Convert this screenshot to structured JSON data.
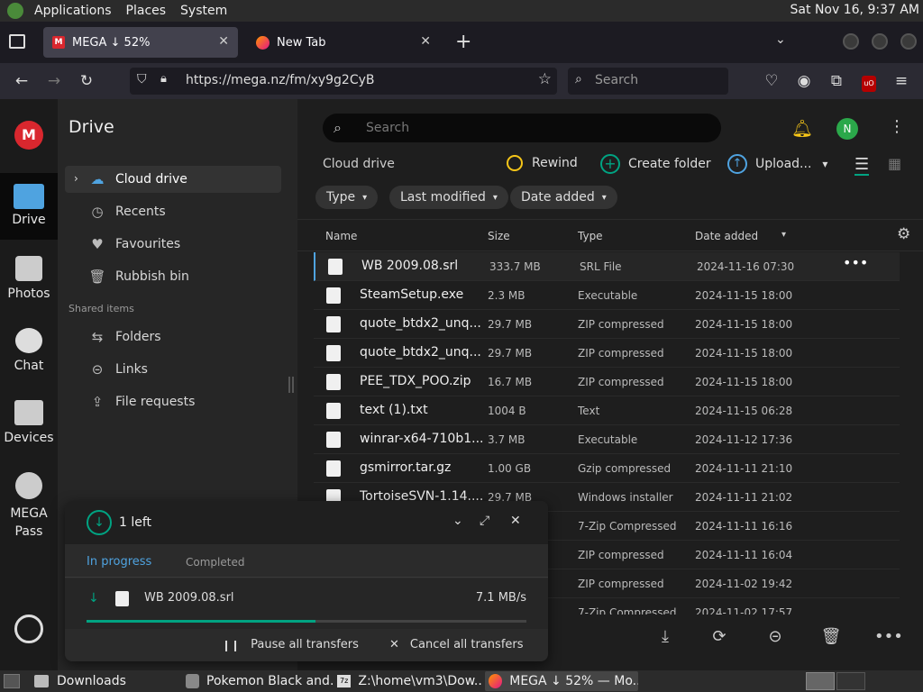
{
  "panel": {
    "menus": [
      "Applications",
      "Places",
      "System"
    ],
    "clock": "Sat Nov 16,  9:37 AM"
  },
  "tabs": [
    {
      "title": "MEGA ↓ 52%"
    },
    {
      "title": "New Tab"
    }
  ],
  "navbar": {
    "url": "https://mega.nz/fm/xy9g2CyB",
    "search_placeholder": "Search"
  },
  "rail": {
    "items": [
      {
        "label": "Drive"
      },
      {
        "label": "Photos"
      },
      {
        "label": "Chat"
      },
      {
        "label": "Devices"
      },
      {
        "label": "MEGA Pass"
      }
    ]
  },
  "sidebar": {
    "title": "Drive",
    "items": [
      {
        "label": "Cloud drive"
      },
      {
        "label": "Recents"
      },
      {
        "label": "Favourites"
      },
      {
        "label": "Rubbish bin"
      }
    ],
    "shared_heading": "Shared items",
    "shared": [
      {
        "label": "Folders"
      },
      {
        "label": "Links"
      },
      {
        "label": "File requests"
      }
    ]
  },
  "main": {
    "search_placeholder": "Search",
    "avatar_letter": "N",
    "breadcrumb": "Cloud drive",
    "actions": {
      "rewind": "Rewind",
      "create_folder": "Create folder",
      "upload": "Upload..."
    },
    "filters": [
      "Type",
      "Last modified",
      "Date added"
    ],
    "columns": {
      "name": "Name",
      "size": "Size",
      "type": "Type",
      "date": "Date added"
    },
    "files": [
      {
        "name": "WB 2009.08.srl",
        "size": "333.7 MB",
        "type": "SRL File",
        "date": "2024-11-16 07:30"
      },
      {
        "name": "SteamSetup.exe",
        "size": "2.3 MB",
        "type": "Executable",
        "date": "2024-11-15 18:00"
      },
      {
        "name": "quote_btdx2_unq...",
        "size": "29.7 MB",
        "type": "ZIP compressed",
        "date": "2024-11-15 18:00"
      },
      {
        "name": "quote_btdx2_unq...",
        "size": "29.7 MB",
        "type": "ZIP compressed",
        "date": "2024-11-15 18:00"
      },
      {
        "name": "PEE_TDX_POO.zip",
        "size": "16.7 MB",
        "type": "ZIP compressed",
        "date": "2024-11-15 18:00"
      },
      {
        "name": "text (1).txt",
        "size": "1004 B",
        "type": "Text",
        "date": "2024-11-15 06:28"
      },
      {
        "name": "winrar-x64-710b1...",
        "size": "3.7 MB",
        "type": "Executable",
        "date": "2024-11-12 17:36"
      },
      {
        "name": "gsmirror.tar.gz",
        "size": "1.00 GB",
        "type": "Gzip compressed",
        "date": "2024-11-11 21:10"
      },
      {
        "name": "TortoiseSVN-1.14....",
        "size": "29.7 MB",
        "type": "Windows installer",
        "date": "2024-11-11 21:02"
      },
      {
        "name": "",
        "size": "",
        "type": "7-Zip Compressed",
        "date": "2024-11-11 16:16"
      },
      {
        "name": "",
        "size": "",
        "type": "ZIP compressed",
        "date": "2024-11-11 16:04"
      },
      {
        "name": "",
        "size": "",
        "type": "ZIP compressed",
        "date": "2024-11-02 19:42"
      },
      {
        "name": "",
        "size": "",
        "type": "7-Zip Compressed",
        "date": "2024-11-02 17:57"
      }
    ]
  },
  "transfers": {
    "left_label": "1 left",
    "tab_in_progress": "In progress",
    "tab_completed": "Completed",
    "item_name": "WB 2009.08.srl",
    "item_speed": "7.1 MB/s",
    "progress": 0.52,
    "pause_all": "Pause all transfers",
    "cancel_all": "Cancel all transfers"
  },
  "taskbar": {
    "tasks": [
      {
        "label": "Downloads"
      },
      {
        "label": "Pokemon Black and..."
      },
      {
        "label": "Z:\\home\\vm3\\Dow..."
      },
      {
        "label": "MEGA ↓ 52% — Mo..."
      }
    ]
  },
  "colors": {
    "mega_red": "#d9272e",
    "accent_teal": "#00a382",
    "link_blue": "#4fa3e0",
    "avatar_green": "#2ba84a",
    "bell_yellow": "#f5c518"
  }
}
